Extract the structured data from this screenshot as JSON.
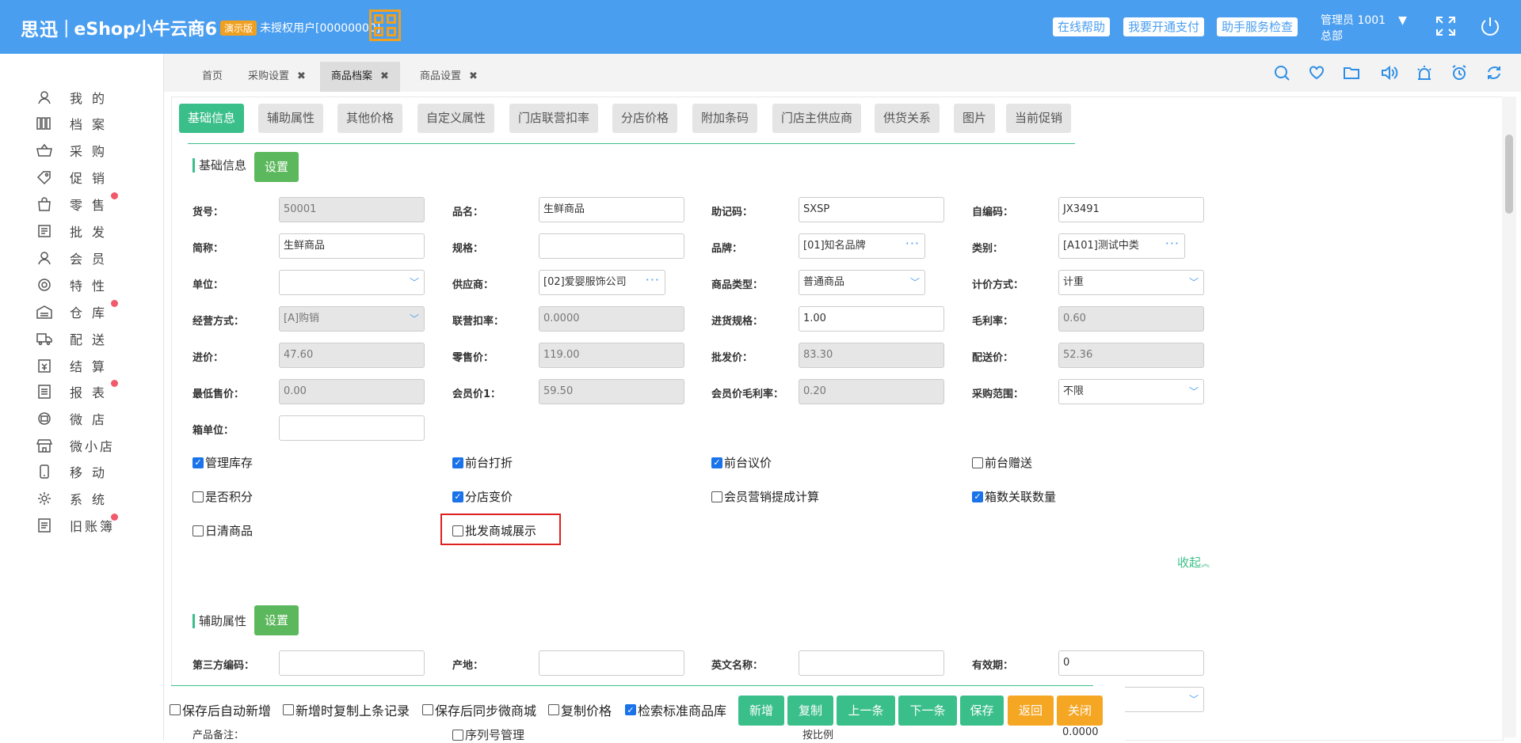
{
  "header": {
    "logo": "思迅",
    "separator": "|",
    "product": "eShop小牛云商6",
    "demo_badge": "演示版",
    "license": "未授权用户[00000000]",
    "buttons": [
      "在线帮助",
      "我要开通支付",
      "助手服务检查"
    ],
    "admin_name": "管理员 1001",
    "admin_caret": "▼",
    "admin_org": "总部",
    "bg_color": "#4a9ef0"
  },
  "sidebar": {
    "items": [
      {
        "label": "我的",
        "icon": "user-icon",
        "dot": false
      },
      {
        "label": "档案",
        "icon": "books-icon",
        "dot": false
      },
      {
        "label": "采购",
        "icon": "basket-icon",
        "dot": false
      },
      {
        "label": "促销",
        "icon": "tag-icon",
        "dot": false
      },
      {
        "label": "零售",
        "icon": "shopping-bag-icon",
        "dot": true
      },
      {
        "label": "批发",
        "icon": "wholesale-icon",
        "dot": false
      },
      {
        "label": "会员",
        "icon": "member-icon",
        "dot": false
      },
      {
        "label": "特性",
        "icon": "target-icon",
        "dot": false
      },
      {
        "label": "仓库",
        "icon": "warehouse-icon",
        "dot": true
      },
      {
        "label": "配送",
        "icon": "truck-icon",
        "dot": false
      },
      {
        "label": "结算",
        "icon": "settlement-icon",
        "dot": false
      },
      {
        "label": "报表",
        "icon": "report-icon",
        "dot": true
      },
      {
        "label": "微店",
        "icon": "micro-shop-icon",
        "dot": false
      },
      {
        "label": "微小店",
        "icon": "store-icon",
        "dot": false
      },
      {
        "label": "移动",
        "icon": "mobile-icon",
        "dot": false
      },
      {
        "label": "系统",
        "icon": "gear-icon",
        "dot": false
      },
      {
        "label": "旧账簿",
        "icon": "ledger-icon",
        "dot": true
      }
    ]
  },
  "tabs": [
    {
      "label": "首页",
      "closable": false,
      "active": false
    },
    {
      "label": "采购设置",
      "closable": true,
      "active": false
    },
    {
      "label": "商品档案",
      "closable": true,
      "active": true
    },
    {
      "label": "商品设置",
      "closable": true,
      "active": false
    }
  ],
  "tab_close": "✖",
  "toolbar_icons": [
    "search-icon",
    "heart-icon",
    "folder-icon",
    "speaker-icon",
    "alarm-light-icon",
    "alarm-clock-icon",
    "refresh-icon"
  ],
  "section_tabs": [
    "基础信息",
    "辅助属性",
    "其他价格",
    "自定义属性",
    "门店联营扣率",
    "分店价格",
    "附加条码",
    "门店主供应商",
    "供货关系",
    "图片",
    "当前促销"
  ],
  "basic_info": {
    "title": "基础信息",
    "set_label": "设置",
    "fields": {
      "item_no": {
        "label": "货号：",
        "value": "50001"
      },
      "item_name": {
        "label": "品名：",
        "value": "生鲜商品"
      },
      "mnemonic": {
        "label": "助记码：",
        "value": "SXSP"
      },
      "self_code": {
        "label": "自编码：",
        "value": "JX3491"
      },
      "short_name": {
        "label": "简称：",
        "value": "生鲜商品"
      },
      "spec": {
        "label": "规格：",
        "value": ""
      },
      "brand": {
        "label": "品牌：",
        "value": "[01]知名品牌"
      },
      "category": {
        "label": "类别：",
        "value": "[A101]测试中类"
      },
      "unit": {
        "label": "单位：",
        "value": ""
      },
      "supplier": {
        "label": "供应商：",
        "value": "[02]爱婴服饰公司"
      },
      "item_type": {
        "label": "商品类型：",
        "value": "普通商品"
      },
      "pricing": {
        "label": "计价方式：",
        "value": "计重"
      },
      "operation": {
        "label": "经营方式：",
        "value": "[A]购销"
      },
      "joint_rate": {
        "label": "联营扣率：",
        "value": "0.0000"
      },
      "purchase_spec": {
        "label": "进货规格：",
        "value": "1.00"
      },
      "margin": {
        "label": "毛利率：",
        "value": "0.60"
      },
      "cost_price": {
        "label": "进价：",
        "value": "47.60"
      },
      "retail_price": {
        "label": "零售价：",
        "value": "119.00"
      },
      "wholesale_price": {
        "label": "批发价：",
        "value": "83.30"
      },
      "delivery_price": {
        "label": "配送价：",
        "value": "52.36"
      },
      "min_price": {
        "label": "最低售价：",
        "value": "0.00"
      },
      "member_price1": {
        "label": "会员价1：",
        "value": "59.50"
      },
      "member_margin": {
        "label": "会员价毛利率：",
        "value": "0.20"
      },
      "purchase_scope": {
        "label": "采购范围：",
        "value": "不限"
      },
      "box_unit": {
        "label": "箱单位：",
        "value": ""
      }
    },
    "checkboxes": [
      {
        "label": "管理库存",
        "checked": true
      },
      {
        "label": "前台打折",
        "checked": true
      },
      {
        "label": "前台议价",
        "checked": true
      },
      {
        "label": "前台赠送",
        "checked": false
      },
      {
        "label": "是否积分",
        "checked": false
      },
      {
        "label": "分店变价",
        "checked": true
      },
      {
        "label": "会员营销提成计算",
        "checked": false
      },
      {
        "label": "箱数关联数量",
        "checked": true
      },
      {
        "label": "日清商品",
        "checked": false
      },
      {
        "label": "批发商城展示",
        "checked": false
      }
    ],
    "collapse_label": "收起",
    "collapse_icon": "double-chevron-up-icon"
  },
  "aux_info": {
    "title": "辅助属性",
    "set_label": "设置",
    "fields": {
      "third_code": {
        "label": "第三方编码：",
        "value": ""
      },
      "origin": {
        "label": "产地：",
        "value": ""
      },
      "english_name": {
        "label": "英文名称：",
        "value": ""
      },
      "validity": {
        "label": "有效期：",
        "value": "0"
      }
    },
    "partial": {
      "remark_label": "产品备注：",
      "serial_label": "序列号管理",
      "mode_value": "按比例",
      "qty_value": "0.0000"
    }
  },
  "bottom": {
    "checkboxes": [
      {
        "label": "保存后自动新增",
        "checked": false
      },
      {
        "label": "新增时复制上条记录",
        "checked": false
      },
      {
        "label": "保存后同步微商城",
        "checked": false
      },
      {
        "label": "复制价格",
        "checked": false
      },
      {
        "label": "检索标准商品库",
        "checked": true
      }
    ],
    "buttons": [
      "新增",
      "复制",
      "上一条",
      "下一条",
      "保存",
      "返回",
      "关闭"
    ]
  },
  "colors": {
    "accent_green": "#3bbf8a",
    "orange": "#f5a623",
    "checkbox_blue": "#1a73e8",
    "highlight_red": "#e02020"
  }
}
